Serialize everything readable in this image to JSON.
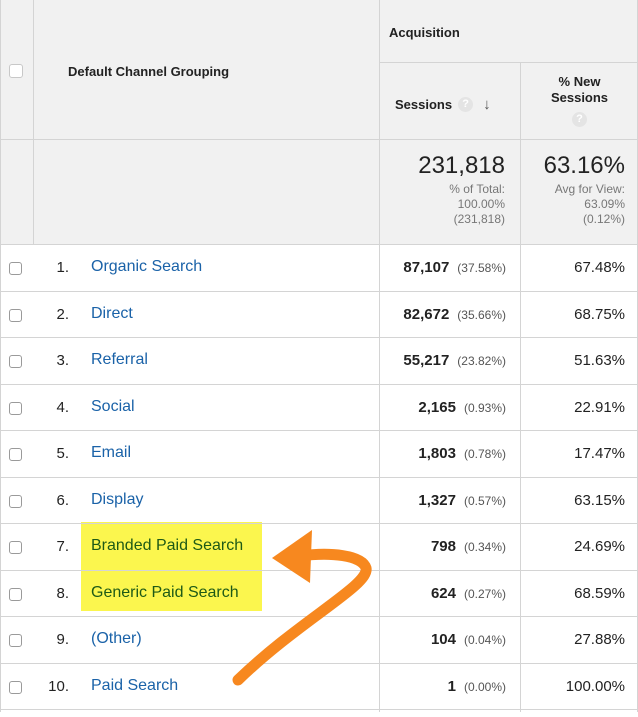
{
  "header": {
    "group_label": "Acquisition",
    "dimension_label": "Default Channel Grouping",
    "sessions_label": "Sessions",
    "new_sessions_label_1": "% New",
    "new_sessions_label_2": "Sessions",
    "help_glyph": "?",
    "sort_glyph": "↓"
  },
  "totals": {
    "sessions": "231,818",
    "sessions_sub1": "% of Total:",
    "sessions_sub2": "100.00%",
    "sessions_sub3": "(231,818)",
    "new_sessions": "63.16%",
    "new_sub1": "Avg for View:",
    "new_sub2": "63.09%",
    "new_sub3": "(0.12%)"
  },
  "rows": [
    {
      "index": "1.",
      "channel": "Organic Search",
      "sessions": "87,107",
      "share": "(37.58%)",
      "new_sessions": "67.48%"
    },
    {
      "index": "2.",
      "channel": "Direct",
      "sessions": "82,672",
      "share": "(35.66%)",
      "new_sessions": "68.75%"
    },
    {
      "index": "3.",
      "channel": "Referral",
      "sessions": "55,217",
      "share": "(23.82%)",
      "new_sessions": "51.63%"
    },
    {
      "index": "4.",
      "channel": "Social",
      "sessions": "2,165",
      "share": "(0.93%)",
      "new_sessions": "22.91%"
    },
    {
      "index": "5.",
      "channel": "Email",
      "sessions": "1,803",
      "share": "(0.78%)",
      "new_sessions": "17.47%"
    },
    {
      "index": "6.",
      "channel": "Display",
      "sessions": "1,327",
      "share": "(0.57%)",
      "new_sessions": "63.15%"
    },
    {
      "index": "7.",
      "channel": "Branded Paid Search",
      "sessions": "798",
      "share": "(0.34%)",
      "new_sessions": "24.69%"
    },
    {
      "index": "8.",
      "channel": "Generic Paid Search",
      "sessions": "624",
      "share": "(0.27%)",
      "new_sessions": "68.59%"
    },
    {
      "index": "9.",
      "channel": "(Other)",
      "sessions": "104",
      "share": "(0.04%)",
      "new_sessions": "27.88%"
    },
    {
      "index": "10.",
      "channel": "Paid Search",
      "sessions": "1",
      "share": "(0.00%)",
      "new_sessions": "100.00%"
    }
  ],
  "colors": {
    "highlight": "#fbf64e",
    "arrow": "#f7881f",
    "link": "#1a62a8",
    "header_bg": "#f1f1f1"
  }
}
